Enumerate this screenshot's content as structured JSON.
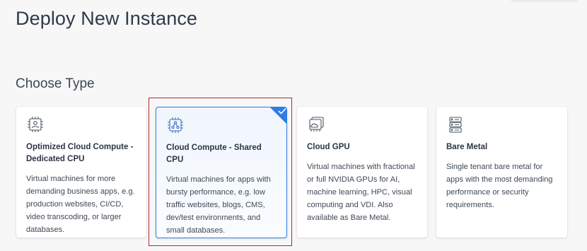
{
  "page": {
    "title": "Deploy New Instance",
    "section_title": "Choose Type"
  },
  "cards": [
    {
      "title": "Optimized Cloud Compute - Dedicated CPU",
      "description": "Virtual machines for more demanding business apps, e.g. production websites, CI/CD, video transcoding, or larger databases.",
      "icon": "cpu-user-icon",
      "selected": false
    },
    {
      "title": "Cloud Compute - Shared CPU",
      "description": "Virtual machines for apps with bursty performance, e.g. low traffic websites, blogs, CMS, dev/test environments, and small databases.",
      "icon": "cpu-share-icon",
      "selected": true
    },
    {
      "title": "Cloud GPU",
      "description": "Virtual machines with fractional or full NVIDIA GPUs for AI, machine learning, HPC, visual computing and VDI. Also available as Bare Metal.",
      "icon": "gpu-cloud-icon",
      "selected": false
    },
    {
      "title": "Bare Metal",
      "description": "Single tenant bare metal for apps with the most demanding performance or security requirements.",
      "icon": "server-rack-icon",
      "selected": false
    }
  ],
  "colors": {
    "accent": "#2f7ce6",
    "selection_outline": "#b8282f",
    "text_dark": "#2b3545"
  }
}
